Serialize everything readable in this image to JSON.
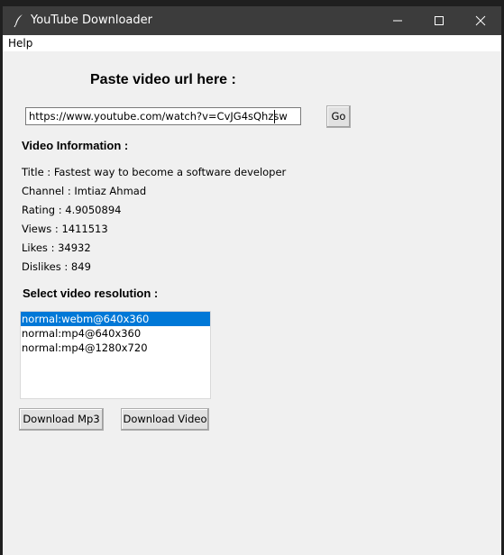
{
  "window": {
    "title": "YouTube Downloader"
  },
  "menu": {
    "items": [
      "Help"
    ]
  },
  "url_section": {
    "heading": "Paste video url here :",
    "url_value": "https://www.youtube.com/watch?v=CvJG4sQhzsw",
    "go_label": "Go"
  },
  "video_info": {
    "heading": "Video Information :",
    "title": "Title : Fastest way to become a software developer",
    "channel": "Channel : Imtiaz Ahmad",
    "rating": "Rating : 4.9050894",
    "views": "Views : 1411513",
    "likes": "Likes : 34932",
    "dislikes": "Dislikes : 849"
  },
  "resolution": {
    "heading": "Select video resolution :",
    "options": [
      "normal:webm@640x360",
      "normal:mp4@640x360",
      "normal:mp4@1280x720"
    ],
    "selected_index": 0
  },
  "actions": {
    "download_mp3": "Download Mp3",
    "download_video": "Download Video"
  },
  "colors": {
    "titlebar": "#3c3c3c",
    "selection": "#0078d7"
  }
}
